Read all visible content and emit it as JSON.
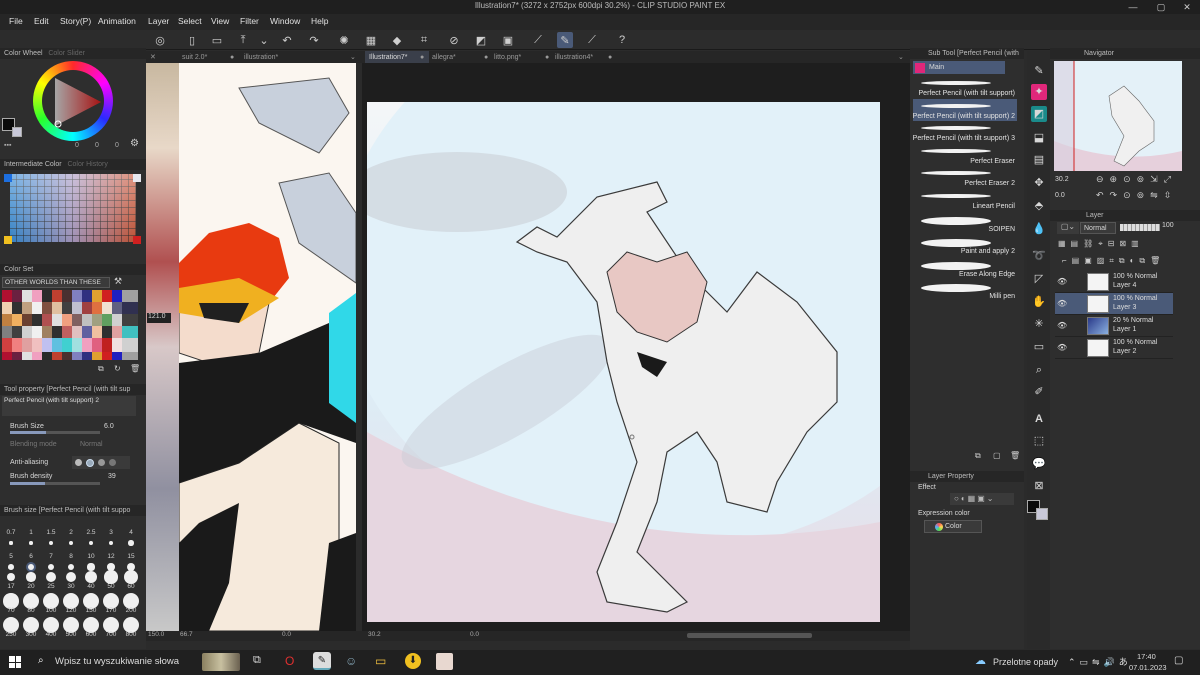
{
  "window": {
    "title": "Illustration7* (3272 x 2752px 600dpi 30.2%) - CLIP STUDIO PAINT EX",
    "minimize": "—",
    "maximize": "▢",
    "close": "✕"
  },
  "menu": [
    "File",
    "Edit",
    "Story(P)",
    "Animation",
    "Layer",
    "Select",
    "View",
    "Filter",
    "Window",
    "Help"
  ],
  "color_wheel": {
    "title": "Color Wheel",
    "slider_tab": "Color Slider",
    "values": [
      "0",
      "0",
      "0"
    ]
  },
  "intermediate_color": {
    "title": "Intermediate Color",
    "history_tab": "Color History"
  },
  "color_set": {
    "title": "Color Set",
    "selected_set": "OTHER WORLDS THAN THESE"
  },
  "tool_property": {
    "title": "Tool property [Perfect Pencil (with tilt sup",
    "brush_name": "Perfect Pencil (with tilt support) 2",
    "brush_size_label": "Brush Size",
    "brush_size_value": "6.0",
    "blending_mode_label": "Blending mode",
    "blending_mode_value": "Normal",
    "anti_aliasing_label": "Anti-aliasing",
    "brush_density_label": "Brush density",
    "brush_density_value": "39"
  },
  "brush_size_panel": {
    "title": "Brush size [Perfect Pencil (with tilt suppo",
    "sizes": [
      "0.7",
      "1",
      "1.5",
      "2",
      "2.5",
      "3",
      "4",
      "5",
      "6",
      "7",
      "8",
      "10",
      "12",
      "15",
      "17",
      "20",
      "25",
      "30",
      "40",
      "50",
      "60",
      "70",
      "80",
      "100",
      "120",
      "150",
      "170",
      "200",
      "250",
      "300",
      "400",
      "500",
      "600",
      "700",
      "800"
    ]
  },
  "ref_canvas": {
    "zoom": "121.0",
    "bottom_zoom": "150.0",
    "bottom_value": "66.7",
    "bottom_angle": "0.0"
  },
  "doc_tabs": {
    "left": [
      "suit 2.0*",
      "illustration*"
    ],
    "main": [
      "Illustration7*",
      "allegra*",
      "litto.png*",
      "illustration4*"
    ]
  },
  "canvas_status": {
    "zoom": "30.2",
    "angle": "0.0"
  },
  "sub_tool": {
    "title": "Sub Tool [Perfect Pencil (with",
    "group": "Main",
    "brushes": [
      "Perfect Pencil (with tilt support)",
      "Perfect Pencil (with tilt support) 2",
      "Perfect Pencil (with tilt support) 3",
      "Perfect Eraser",
      "Perfect Eraser 2",
      "Lineart Pencil",
      "SOIPEN",
      "Paint and apply 2",
      "Erase Along Edge",
      "Milli pen"
    ]
  },
  "layer_property": {
    "title": "Layer Property",
    "effect_label": "Effect",
    "expression_color_label": "Expression color",
    "expression_color_value": "Color"
  },
  "navigator": {
    "title": "Navigator",
    "zoom": "30.2",
    "angle": "0.0"
  },
  "layer_panel": {
    "title": "Layer",
    "blend_mode": "Normal",
    "opacity": "100",
    "layers": [
      {
        "line1": "100 % Normal",
        "line2": "Layer 4"
      },
      {
        "line1": "100 % Normal",
        "line2": "Layer 3"
      },
      {
        "line1": "20 % Normal",
        "line2": "Layer 1"
      },
      {
        "line1": "100 % Normal",
        "line2": "Layer 2"
      }
    ]
  },
  "taskbar": {
    "search_placeholder": "Wpisz tu wyszukiwanie słowa",
    "weather": "Przelotne opady",
    "time": "17:40",
    "date": "07.01.2023"
  },
  "colors": {
    "accent": "#4a5a78",
    "main_tab": "#e0277a",
    "taskbar": "#202020"
  }
}
